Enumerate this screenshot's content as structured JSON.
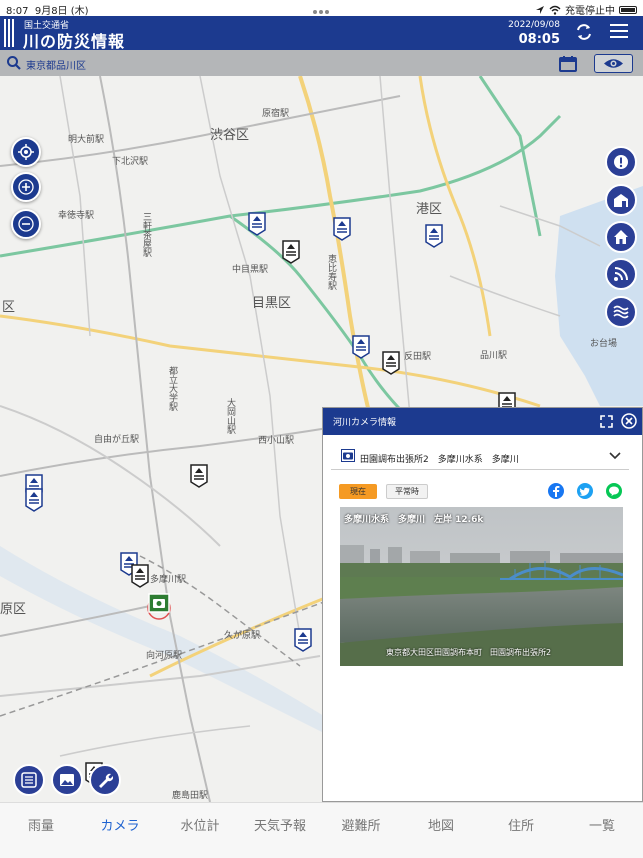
{
  "status_bar": {
    "time": "8:07",
    "date": "9月8日 (木)",
    "battery_text": "充電停止中"
  },
  "header": {
    "ministry": "国土交通省",
    "title": "川の防災情報",
    "date": "2022/09/08",
    "time": "08:05",
    "color": "#1c3a8f"
  },
  "search": {
    "location": "東京都品川区"
  },
  "map": {
    "labels": [
      {
        "text": "渋谷区",
        "kind": "ward"
      },
      {
        "text": "港区",
        "kind": "ward"
      },
      {
        "text": "目黒区",
        "kind": "ward"
      },
      {
        "text": "区",
        "kind": "ward"
      },
      {
        "text": "原区",
        "kind": "ward"
      },
      {
        "text": "明大前駅"
      },
      {
        "text": "下北沢駅"
      },
      {
        "text": "幸徳寺駅"
      },
      {
        "text": "三軒茶屋駅"
      },
      {
        "text": "中目黒駅"
      },
      {
        "text": "恵比寿駅"
      },
      {
        "text": "反田駅"
      },
      {
        "text": "品川駅"
      },
      {
        "text": "都立大学駅"
      },
      {
        "text": "自由が丘駅"
      },
      {
        "text": "大岡山駅"
      },
      {
        "text": "西小山駅"
      },
      {
        "text": "多摩川駅"
      },
      {
        "text": "久が原駅"
      },
      {
        "text": "向河原駅"
      },
      {
        "text": "原宿駅"
      },
      {
        "text": "お台場"
      },
      {
        "text": "鹿島田駅"
      }
    ]
  },
  "camera_panel": {
    "title": "河川カメラ情報",
    "station": "田園調布出張所2　多摩川水系　多摩川",
    "tab_now": "現在",
    "tab_normal": "平常時",
    "caption_top": "多摩川水系　多摩川　左岸 12.6k",
    "caption_bottom": "東京都大田区田園調布本町　田園調布出張所2",
    "share": [
      "facebook-icon",
      "twitter-icon",
      "line-icon"
    ]
  },
  "tabbar": {
    "items": [
      {
        "label": "雨量"
      },
      {
        "label": "カメラ"
      },
      {
        "label": "水位計"
      },
      {
        "label": "天気予報"
      },
      {
        "label": "避難所"
      },
      {
        "label": "地図"
      },
      {
        "label": "住所"
      },
      {
        "label": "一覧"
      }
    ],
    "active_color": "#1e62d0"
  }
}
